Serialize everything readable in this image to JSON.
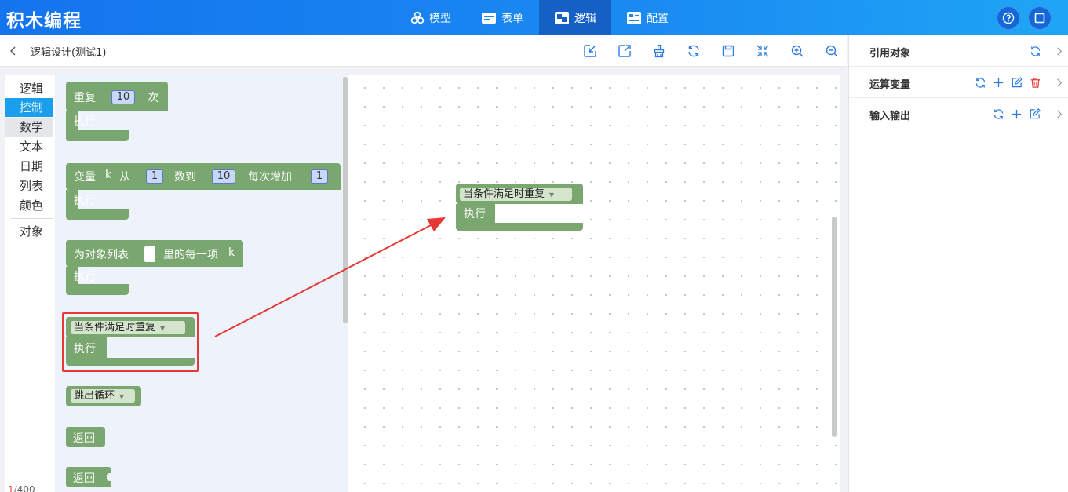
{
  "app": {
    "title": "积木编程"
  },
  "nav": {
    "tabs": [
      {
        "label": "模型",
        "icon": "cubes-icon"
      },
      {
        "label": "表单",
        "icon": "form-icon"
      },
      {
        "label": "逻辑",
        "icon": "logic-blocks-icon",
        "active": true
      },
      {
        "label": "配置",
        "icon": "config-icon"
      }
    ]
  },
  "header_icons": [
    "help-icon",
    "fullscreen-icon"
  ],
  "subheader": {
    "title": "逻辑设计(测试1)"
  },
  "toolbar": [
    "import-icon",
    "export-icon",
    "clean-icon",
    "refresh-icon",
    "save-icon",
    "collapse-icon",
    "zoom-in-icon",
    "zoom-out-icon"
  ],
  "categories": [
    {
      "label": "逻辑"
    },
    {
      "label": "控制",
      "selected": true
    },
    {
      "label": "数学",
      "hover": true
    },
    {
      "label": "文本"
    },
    {
      "label": "日期"
    },
    {
      "label": "列表"
    },
    {
      "label": "颜色"
    },
    {
      "label": "对象"
    }
  ],
  "blocks": {
    "repeat": {
      "label": "重复",
      "times": "10",
      "suffix": "次",
      "do": "执行"
    },
    "for": {
      "var_label": "变量",
      "var": "k",
      "from_label": "从",
      "from": "1",
      "to_label": "数到",
      "to": "10",
      "step_label": "每次增加",
      "step": "1",
      "do": "执行"
    },
    "foreach": {
      "label": "为对象列表",
      "mid": "里的每一项",
      "var": "k",
      "do": "执行"
    },
    "while": {
      "mode": "当条件满足时重复",
      "do": "执行"
    },
    "break": {
      "mode": "跳出循环"
    },
    "return": {
      "label": "返回"
    },
    "return2": {
      "label": "返回"
    }
  },
  "canvas_block": {
    "mode": "当条件满足时重复",
    "do": "执行"
  },
  "counter": {
    "current": "1",
    "total": "/400"
  },
  "right_panel": {
    "rows": [
      {
        "label": "引用对象",
        "icons": [
          "refresh-icon"
        ]
      },
      {
        "label": "运算变量",
        "icons": [
          "refresh-icon",
          "add-icon",
          "edit-icon",
          "delete-icon"
        ]
      },
      {
        "label": "输入输出",
        "icons": [
          "refresh-icon",
          "add-icon",
          "edit-icon"
        ]
      }
    ]
  },
  "colors": {
    "accent": "#1b9fec",
    "block": "#7aa66f",
    "highlight": "#e53935"
  }
}
